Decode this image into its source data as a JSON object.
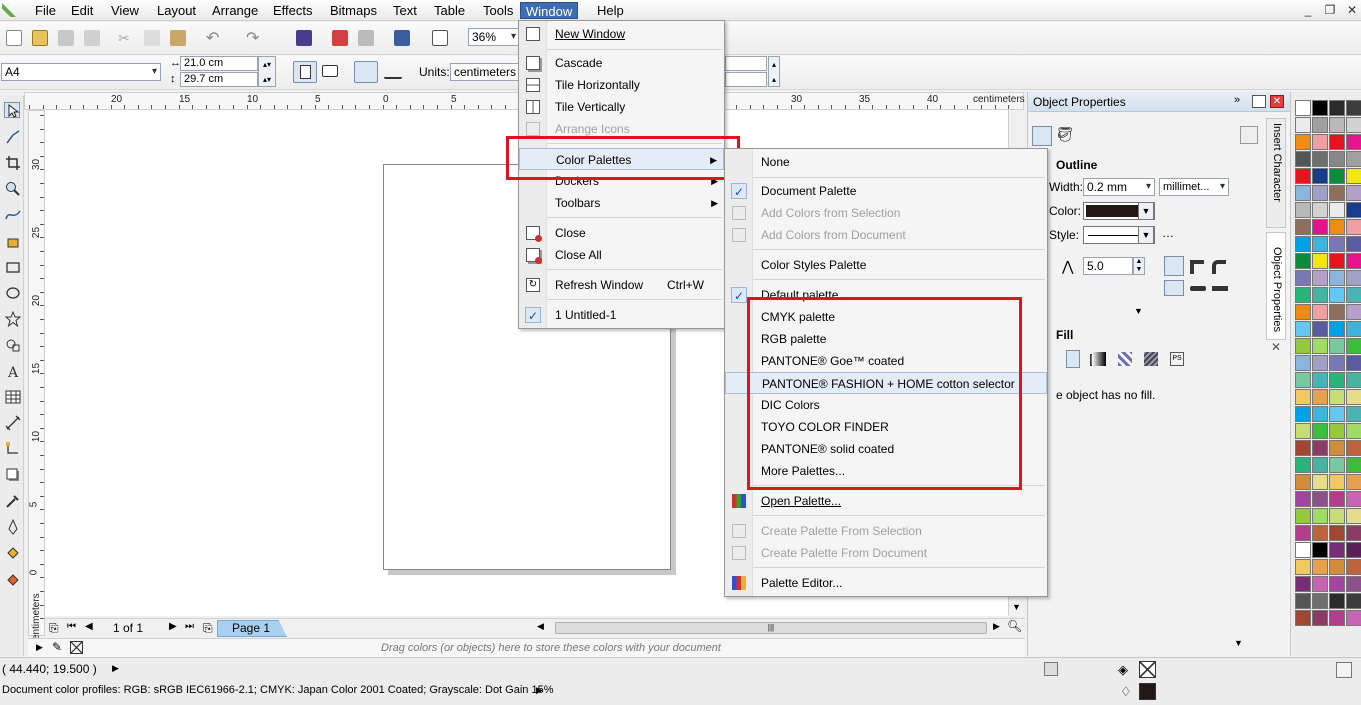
{
  "menubar": {
    "items": [
      "File",
      "Edit",
      "View",
      "Layout",
      "Arrange",
      "Effects",
      "Bitmaps",
      "Text",
      "Table",
      "Tools",
      "Window",
      "Help"
    ],
    "active": "Window"
  },
  "toolbar": {
    "zoom_value": "36%"
  },
  "property_bar": {
    "page_size": "A4",
    "width": "21.0 cm",
    "height": "29.7 cm",
    "units_label": "Units:",
    "units_value": "centimeters"
  },
  "ruler": {
    "h_ticks": [
      "20",
      "15",
      "10",
      "5",
      "0",
      "5",
      "30",
      "35",
      "40"
    ],
    "h_unit": "centimeters",
    "v_ticks": [
      "30",
      "25",
      "20",
      "15",
      "10",
      "5",
      "0"
    ],
    "v_unit": "centimeters"
  },
  "window_menu": {
    "items": [
      {
        "label": "New Window",
        "icon": "new-window-icon"
      },
      {
        "label": "Cascade",
        "icon": "cascade-icon"
      },
      {
        "label": "Tile Horizontally",
        "icon": "tile-horizontal-icon"
      },
      {
        "label": "Tile Vertically",
        "icon": "tile-vertical-icon"
      },
      {
        "label": "Arrange Icons",
        "icon": "arrange-icons-icon",
        "disabled": true
      },
      {
        "label": "Color Palettes",
        "submenu": true,
        "highlighted": true
      },
      {
        "label": "Dockers",
        "submenu": true
      },
      {
        "label": "Toolbars",
        "submenu": true
      },
      {
        "label": "Close",
        "icon": "close-window-icon"
      },
      {
        "label": "Close All",
        "icon": "close-all-icon"
      },
      {
        "label": "Refresh Window",
        "shortcut": "Ctrl+W",
        "icon": "refresh-icon"
      },
      {
        "label": "1 Untitled-1",
        "checked": true
      }
    ]
  },
  "palettes_menu": {
    "items": [
      {
        "label": "None"
      },
      {
        "label": "Document Palette",
        "checked": true
      },
      {
        "label": "Add Colors from Selection",
        "disabled": true
      },
      {
        "label": "Add Colors from Document",
        "disabled": true
      },
      {
        "label": "Color Styles Palette"
      },
      {
        "label": "Default palette",
        "checked": true
      },
      {
        "label": "CMYK palette"
      },
      {
        "label": "RGB palette"
      },
      {
        "label": "PANTONE® Goe™ coated"
      },
      {
        "label": "PANTONE® FASHION + HOME cotton selector"
      },
      {
        "label": "DIC Colors"
      },
      {
        "label": "TOYO COLOR FINDER"
      },
      {
        "label": "PANTONE® solid coated"
      },
      {
        "label": "More Palettes..."
      },
      {
        "label": "Open Palette..."
      },
      {
        "label": "Create Palette From Selection",
        "disabled": true
      },
      {
        "label": "Create Palette From Document",
        "disabled": true
      },
      {
        "label": "Palette Editor..."
      }
    ]
  },
  "docker": {
    "title": "Object Properties",
    "outline_heading": "Outline",
    "width_label": "Width:",
    "width_value": "0.2 mm",
    "units_value": "millimet...",
    "color_label": "Color:",
    "style_label": "Style:",
    "miter_value": "5.0",
    "fill_heading": "Fill",
    "fill_message": "e object has no fill.",
    "side_tabs": [
      "Insert Character",
      "Object Properties"
    ]
  },
  "page_nav": {
    "counter": "1 of 1",
    "tab": "Page 1"
  },
  "doc_palette_hint": "Drag colors (or objects) here to store these colors with your document",
  "status": {
    "coords": "( 44.440; 19.500 )",
    "profiles": "Document color profiles: RGB: sRGB IEC61966-2.1; CMYK: Japan Color 2001 Coated; Grayscale: Dot Gain 15%"
  },
  "palette_colors": [
    "#ffffff",
    "#000000",
    "#2b2b2b",
    "#3c3c3c",
    "#555555",
    "#6e6e6e",
    "#888888",
    "#a0a0a0",
    "#b9b9b9",
    "#d2d2d2",
    "#ebebeb",
    "#1a3c8c",
    "#0a8c3c",
    "#f0e614",
    "#e6141e",
    "#e6148c",
    "#f08c14",
    "#f0a0a0",
    "#8c6e5a",
    "#b4a0c8",
    "#8cb4dc",
    "#a0a0c8",
    "#7878b4",
    "#5a5aa0",
    "#00a0e6",
    "#3cb4dc",
    "#64c8f0",
    "#4ab4b4",
    "#2ab47c",
    "#46b4a0",
    "#78c8a0",
    "#3cbe3c",
    "#96c83c",
    "#a0dc64",
    "#c8dc78",
    "#e6dc8c",
    "#f0c864",
    "#e6a050",
    "#d28c3c",
    "#be643c",
    "#a04632",
    "#8c3c64",
    "#b43c8c",
    "#c864b4",
    "#a046a0",
    "#8c508c",
    "#782d78",
    "#5a1e5a"
  ],
  "colors": {
    "accent": "#3d6eb4",
    "redbox": "#e0141e",
    "page_tab": "#a8d0f0"
  }
}
